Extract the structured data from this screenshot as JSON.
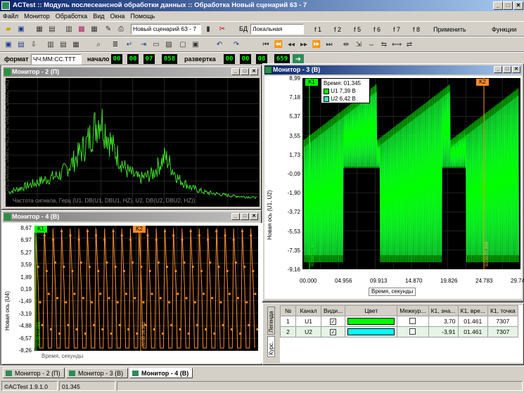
{
  "app": {
    "title": "ACTest :: Модуль послесеансной обработки данных :: Обработка Новый сценарий 63 - 7",
    "win_buttons": [
      "_",
      "□",
      "✕"
    ]
  },
  "menu": [
    "Файл",
    "Монитор",
    "Обработка",
    "Вид",
    "Окна",
    "Помощь"
  ],
  "toolbar1": {
    "scenario": "Новый сценарий 63 - 7",
    "db_label": "БД",
    "db_value": "Локальная",
    "f_buttons": [
      "f 1",
      "f 2",
      "f 5",
      "f 6",
      "f 7",
      "f 8"
    ],
    "apply": "Применить",
    "functions": "Функции"
  },
  "toolbar3": {
    "format_label": "формат",
    "format_value": "ЧЧ:ММ:СС.ТТТ",
    "start_label": "начало",
    "start_digits": [
      "00",
      "00",
      "07",
      "058"
    ],
    "sweep_label": "развертка",
    "sweep_digits": [
      "00",
      "00",
      "08",
      "659"
    ]
  },
  "mon2": {
    "title": "Монитор - 2 (П)",
    "ylabel": "U1, DB(U1, DBU1, HZ), U2, DB(U2, DBU2, HZ)",
    "xlabel": "Частота сигнала, Герц (U1, DB(U1, DBU1, HZ), U2, DB(U2, DBU2, HZ))"
  },
  "mon4": {
    "title": "Монитор - 4 (В)",
    "ylabel": "Новая ось (U4)",
    "xlabel": "Время, секунды",
    "yticks": [
      "8,67",
      "6,97",
      "5,27",
      "3,59",
      "1,89",
      "0,19",
      "-1,49",
      "-3,19",
      "-4,88",
      "-6,57",
      "-8,26"
    ],
    "k1": "K1",
    "k2": "K2",
    "k1_time": "00:00:07.058",
    "k2_time": "00:00:16.962",
    "color": "#ff8c2a"
  },
  "mon3": {
    "title": "Монитор - 3 (В)",
    "ylabel": "Новая ось (U1, U2)",
    "xlabel": "Время, секунды",
    "yticks": [
      "8,99",
      "7,18",
      "5,37",
      "3,55",
      "1,73",
      "-0,09",
      "-1,90",
      "-3,72",
      "-5,53",
      "-7,35",
      "-9,16"
    ],
    "xticks": [
      "00.000",
      "04.956",
      "09.913",
      "14.870",
      "19.826",
      "24.783",
      "29.740"
    ],
    "k1": "K1",
    "k2": "K2",
    "k1_time": "00:00:01.345",
    "k2_time": "00:00:21.996",
    "tooltip": {
      "time": "Время: 01.345",
      "u1": "U1 7,39 В",
      "u2": "U2 6,42 В"
    },
    "colors": {
      "u1": "#00ff00",
      "u2": "#40e0c0"
    }
  },
  "cursor_table": {
    "side_tabs": [
      "Легенда",
      "Курс."
    ],
    "headers": [
      "№",
      "Канал",
      "Види...",
      "Цвет",
      "Межкур...",
      "К1, зна...",
      "К1, вре...",
      "К1, точка"
    ],
    "rows": [
      {
        "n": "1",
        "channel": "U1",
        "visible": "✓",
        "color": "#00ff00",
        "between": "",
        "k1_value": "3,70",
        "k1_time": "01.461",
        "k1_point": "7307"
      },
      {
        "n": "2",
        "channel": "U2",
        "visible": "✓",
        "color": "#00ffff",
        "between": "",
        "k1_value": "-3,91",
        "k1_time": "01.461",
        "k1_point": "7307"
      }
    ]
  },
  "taskbar_tabs": [
    "Монитор - 2 (П)",
    "Монитор - 3 (В)",
    "Монитор - 4 (В)"
  ],
  "status": {
    "version": "©ACTest 1.9.1.0",
    "time": "01.345"
  },
  "chart_data": [
    {
      "type": "line",
      "title": "Монитор - 2 (П)",
      "xlabel": "Частота сигнала, Герц (U1, DB(U1, DBU1, HZ), U2, DB(U2, DBU2, HZ))",
      "ylabel": "U1, DB(U1, DBU1, HZ), U2, DB(U2, DBU2, HZ)",
      "series": [
        {
          "name": "U1",
          "values": [
            0.1,
            0.15,
            0.2,
            0.25,
            0.3,
            0.45,
            0.65,
            0.95,
            0.6,
            0.35,
            0.25,
            0.3,
            0.5,
            0.25,
            0.15,
            0.1,
            0.08,
            0.06,
            0.05,
            0.04
          ]
        }
      ]
    },
    {
      "type": "line",
      "title": "Монитор - 3 (В)",
      "xlabel": "Время, секунды",
      "ylabel": "Новая ось (U1, U2)",
      "xticks": [
        "00.000",
        "04.956",
        "09.913",
        "14.870",
        "19.826",
        "24.783",
        "29.740"
      ],
      "ylim": [
        -9.16,
        8.99
      ],
      "series": [
        {
          "name": "U1",
          "values": [
            7.39
          ]
        },
        {
          "name": "U2",
          "values": [
            6.42
          ]
        }
      ]
    },
    {
      "type": "line",
      "title": "Монитор - 4 (В)",
      "xlabel": "Время, секунды",
      "ylabel": "Новая ось (U4)",
      "ylim": [
        -8.26,
        8.67
      ],
      "series": [
        {
          "name": "U4",
          "values": []
        }
      ]
    }
  ]
}
